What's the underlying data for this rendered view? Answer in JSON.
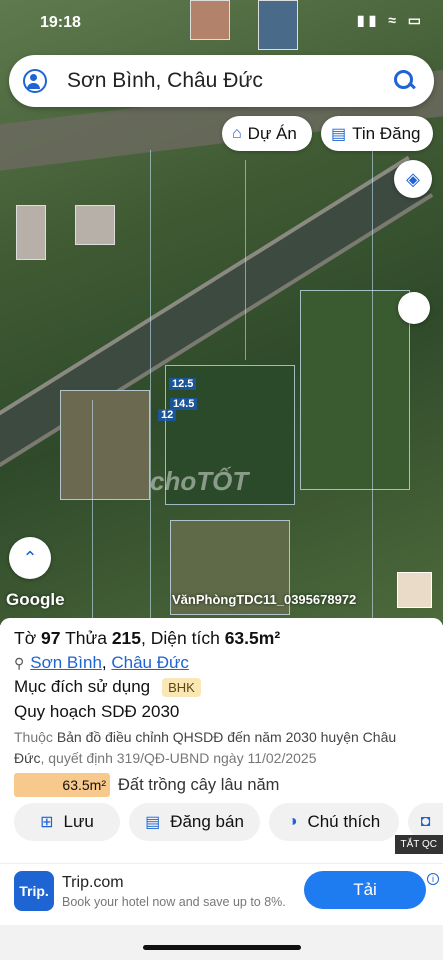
{
  "status": {
    "time": "19:18",
    "icons": "▮▮ ≈ ▭"
  },
  "search": {
    "text": "Sơn Bình, Châu Đức"
  },
  "pills": {
    "du_an": "Dự Án",
    "tin_dang": "Tin Đăng"
  },
  "map": {
    "labels": [
      "12.5",
      "14.5",
      "12"
    ],
    "watermark": "choTỐT",
    "google": "Google",
    "credit": "VănPhòngTDC11_0395678972"
  },
  "parcel": {
    "to_label": "Tờ",
    "to_value": "97",
    "thua_label": "Thửa",
    "thua_value": "215",
    "area_label": "Diện tích",
    "area_value": "63.5m²",
    "location_a": "Sơn Bình",
    "location_sep": ",",
    "location_b": "Châu Đức",
    "purpose_label": "Mục đích sử dụng",
    "purpose_badge": "BHK",
    "planning_label": "Quy hoạch SDĐ 2030",
    "planning_prefix": "Thuộc",
    "planning_dark": "Bản đồ điều chỉnh QHSDĐ đến năm 2030 huyện Châu Đức",
    "planning_suffix": ", quyết định 319/QĐ-UBND ngày 11/02/2025",
    "land_area": "63.5m²",
    "land_type": "Đất trồng cây lâu năm"
  },
  "actions": {
    "save": "Lưu",
    "post": "Đăng bán",
    "legend": "Chú thích"
  },
  "ad": {
    "tag": "TẮT QC",
    "logo": "Trip.",
    "title": "Trip.com",
    "subtitle": "Book your hotel now and save up to 8%.",
    "button": "Tải",
    "info": "i"
  }
}
